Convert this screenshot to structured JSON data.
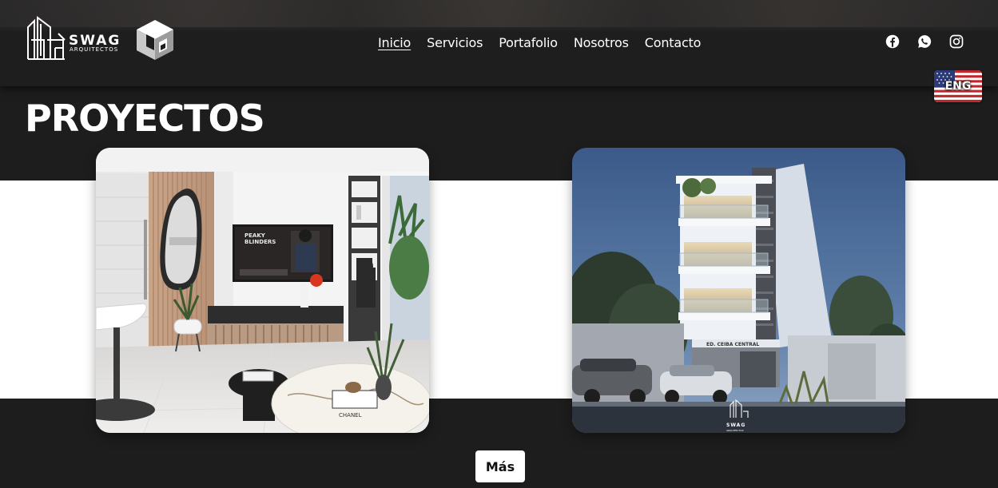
{
  "brand": {
    "name": "SWAG",
    "tagline": "ARQUITECTOS",
    "watermark_name": "SWAG",
    "watermark_tagline": "ARQUITECTOS"
  },
  "nav": {
    "items": [
      {
        "label": "Inicio",
        "active": true
      },
      {
        "label": "Servicios",
        "active": false
      },
      {
        "label": "Portafolio",
        "active": false
      },
      {
        "label": "Nosotros",
        "active": false
      },
      {
        "label": "Contacto",
        "active": false
      }
    ]
  },
  "social": [
    {
      "icon": "facebook-icon"
    },
    {
      "icon": "whatsapp-icon"
    },
    {
      "icon": "instagram-icon"
    }
  ],
  "language_toggle": {
    "label": "ENG",
    "flag": "us-flag-icon"
  },
  "section": {
    "title": "PROYECTOS",
    "more_button": "Más"
  },
  "projects": [
    {
      "name": "interior-living-room",
      "tv_text": "PEAKY BLINDERS",
      "book_text": "CHANEL"
    },
    {
      "name": "building-exterior",
      "sign_text": "ED. CEIBA CENTRAL"
    }
  ],
  "colors": {
    "background": "#1e1d1d",
    "header": "#1f1e1e",
    "band": "#ffffff",
    "text": "#ffffff",
    "button_bg": "#ffffff",
    "button_text": "#111111"
  }
}
